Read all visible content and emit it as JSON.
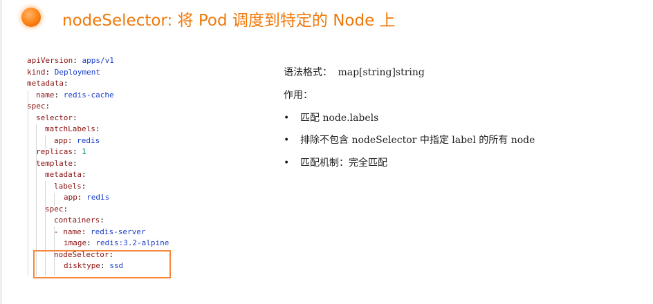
{
  "title": "nodeSelector: 将 Pod 调度到特定的 Node 上",
  "code_lines": [
    {
      "key": "apiVersion",
      "value": "apps/v1"
    },
    {
      "key": "kind",
      "value": "Deployment"
    },
    {
      "key": "metadata",
      "value": ""
    },
    {
      "key": "name",
      "value": "redis-cache"
    },
    {
      "key": "spec",
      "value": ""
    },
    {
      "key": "selector",
      "value": ""
    },
    {
      "key": "matchLabels",
      "value": ""
    },
    {
      "key": "app",
      "value": "redis"
    },
    {
      "key": "replicas",
      "value": "1"
    },
    {
      "key": "template",
      "value": ""
    },
    {
      "key": "metadata",
      "value": ""
    },
    {
      "key": "labels",
      "value": ""
    },
    {
      "key": "app",
      "value": "redis"
    },
    {
      "key": "spec",
      "value": ""
    },
    {
      "key": "containers",
      "value": ""
    },
    {
      "key": "- name",
      "value": "redis-server"
    },
    {
      "key": "image",
      "value": "redis:3.2-alpine"
    },
    {
      "key": "nodeSelector",
      "value": ""
    },
    {
      "key": "disktype",
      "value": "ssd"
    }
  ],
  "syntax": {
    "label": "语法格式：",
    "value": "map[string]string"
  },
  "purpose_label": "作用：",
  "bullet_char": "•",
  "bullets": [
    "匹配 node.labels",
    "排除不包含 nodeSelector 中指定 label 的所有 node",
    "匹配机制：完全匹配"
  ]
}
